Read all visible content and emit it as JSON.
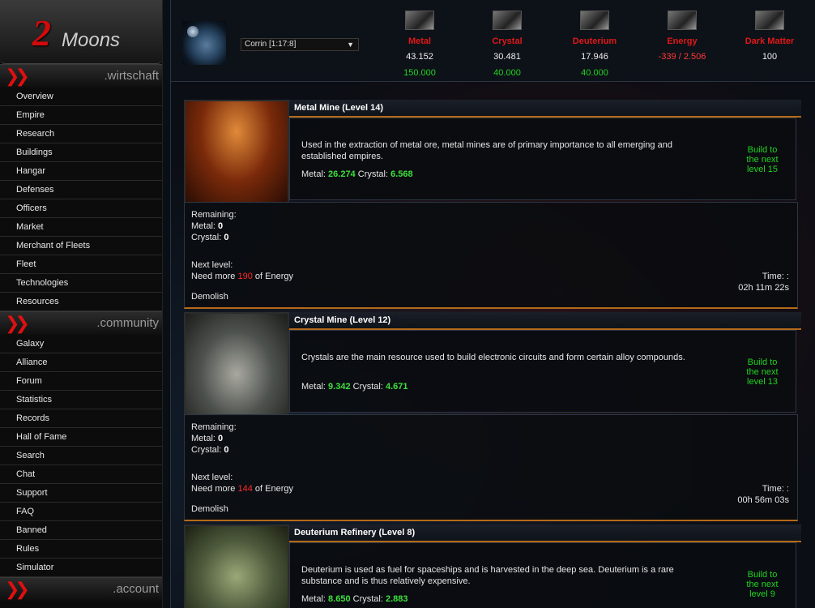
{
  "logo": {
    "number": "2",
    "text": "Moons"
  },
  "sidebar": {
    "sections": [
      {
        "label": ".wirtschaft",
        "items": [
          "Overview",
          "Empire",
          "Research",
          "Buildings",
          "Hangar",
          "Defenses",
          "Officers",
          "Market",
          "Merchant of Fleets",
          "Fleet",
          "Technologies",
          "Resources"
        ]
      },
      {
        "label": ".community",
        "items": [
          "Galaxy",
          "Alliance",
          "Forum",
          "Statistics",
          "Records",
          "Hall of Fame",
          "Search",
          "Chat",
          "Support",
          "FAQ",
          "Banned",
          "Rules",
          "Simulator"
        ]
      },
      {
        "label": ".account",
        "items": []
      }
    ]
  },
  "header": {
    "planet_select": "Corrin [1:17:8]",
    "resources": [
      {
        "name": "Metal",
        "amount": "43.152",
        "cap": "150.000",
        "icon": "metal-icon"
      },
      {
        "name": "Crystal",
        "amount": "30.481",
        "cap": "40.000",
        "icon": "crystal-icon"
      },
      {
        "name": "Deuterium",
        "amount": "17.946",
        "cap": "40.000",
        "icon": "deuterium-icon"
      },
      {
        "name": "Energy",
        "amount": "-339 / 2.506",
        "cap": "",
        "icon": "energy-icon"
      },
      {
        "name": "Dark Matter",
        "amount": "100",
        "cap": "",
        "icon": "dark-matter-icon"
      }
    ]
  },
  "buildings": [
    {
      "title": "Metal Mine (Level 14)",
      "description": "Used in the extraction of metal ore, metal mines are of primary importance to all emerging and established empires.",
      "metal_label": "Metal:",
      "metal_cost": "26.274",
      "crystal_label": "Crystal:",
      "crystal_cost": "6.568",
      "next": "Build to the next level 15",
      "remaining_label": "Remaining:",
      "rem_metal_label": "Metal:",
      "rem_metal": "0",
      "rem_crystal_label": "Crystal:",
      "rem_crystal": "0",
      "next_level_label": "Next level:",
      "need_prefix": "Need more",
      "need_energy": "190",
      "need_suffix": "of Energy",
      "time_label": "Time: :",
      "time": "02h 11m 22s",
      "demolish": "Demolish"
    },
    {
      "title": "Crystal Mine (Level 12)",
      "description": "Crystals are the main resource used to build electronic circuits and form certain alloy compounds.",
      "metal_label": "Metal:",
      "metal_cost": "9.342",
      "crystal_label": "Crystal:",
      "crystal_cost": "4.671",
      "next": "Build to the next level 13",
      "remaining_label": "Remaining:",
      "rem_metal_label": "Metal:",
      "rem_metal": "0",
      "rem_crystal_label": "Crystal:",
      "rem_crystal": "0",
      "next_level_label": "Next level:",
      "need_prefix": "Need more",
      "need_energy": "144",
      "need_suffix": "of Energy",
      "time_label": "Time: :",
      "time": "00h 56m 03s",
      "demolish": "Demolish"
    },
    {
      "title": "Deuterium Refinery (Level 8)",
      "description": "Deuterium is used as fuel for spaceships and is harvested in the deep sea. Deuterium is a rare substance and is thus relatively expensive.",
      "metal_label": "Metal:",
      "metal_cost": "8.650",
      "crystal_label": "Crystal:",
      "crystal_cost": "2.883",
      "next": "Build to the next level 9"
    }
  ],
  "colors": {
    "accent_red": "#e01818",
    "positive_green": "#21d321",
    "divider_orange": "#b56a1a"
  }
}
